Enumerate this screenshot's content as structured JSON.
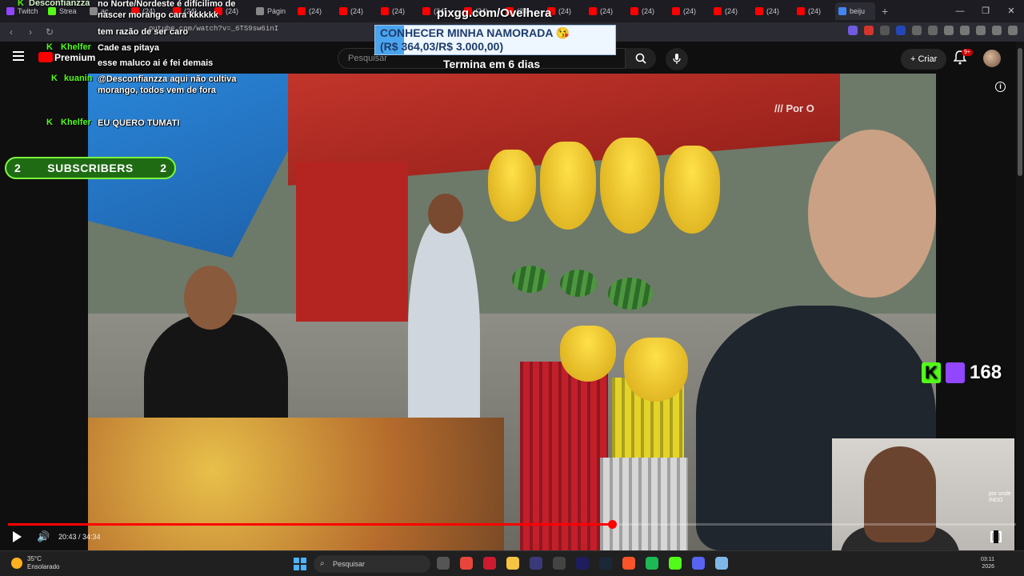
{
  "browser": {
    "tabs": [
      {
        "label": "Twitch",
        "color": "#9146ff"
      },
      {
        "label": "Strea",
        "color": "#53fc18"
      },
      {
        "label": "ac",
        "color": "#888888"
      },
      {
        "label": "(24)",
        "color": "#ff0000"
      },
      {
        "label": "(24)",
        "color": "#ff0000"
      },
      {
        "label": "(24)",
        "color": "#ff0000"
      },
      {
        "label": "Págin",
        "color": "#888888"
      },
      {
        "label": "(24)",
        "color": "#ff0000"
      },
      {
        "label": "(24)",
        "color": "#ff0000"
      },
      {
        "label": "(24)",
        "color": "#ff0000"
      },
      {
        "label": "(24)",
        "color": "#ff0000"
      },
      {
        "label": "(24)",
        "color": "#ff0000"
      },
      {
        "label": "(24)",
        "color": "#ff0000"
      },
      {
        "label": "(24)",
        "color": "#ff0000"
      },
      {
        "label": "(24)",
        "color": "#ff0000"
      },
      {
        "label": "(24)",
        "color": "#ff0000"
      },
      {
        "label": "(24)",
        "color": "#ff0000"
      },
      {
        "label": "(24)",
        "color": "#ff0000"
      },
      {
        "label": "(24)",
        "color": "#ff0000"
      },
      {
        "label": "(24)",
        "color": "#ff0000"
      },
      {
        "label": "beiju",
        "color": "#4285f4",
        "active": true
      }
    ],
    "address": "outube.com/watch?v=_6TS9sw6inI"
  },
  "youtube": {
    "premium_label": "Premium",
    "search_placeholder": "Pesquisar",
    "create_label": "Criar",
    "notif_badge": "9+"
  },
  "overlay": {
    "pix_banner": "pixgg.com/Ovelhera",
    "goal_title": "CONHECER MINHA NAMORADA 😘",
    "goal_amount": "(R$ 364,03/R$ 3.000,00)",
    "goal_progress": 0.1213,
    "goal_days": "Termina em 6 dias",
    "subs_left": "2",
    "subs_label": "SUBSCRIBERS",
    "subs_right": "2",
    "viewer_count": "168",
    "watermark": "/// Por O",
    "corner_logo": "por onde INDO"
  },
  "chat": [
    {
      "user": "Desconfianzza",
      "text": "no Norte/Nordeste é difícilimo de nascer morango cara kkkkkk"
    },
    {
      "user": "",
      "text": "tem razão de ser caro"
    },
    {
      "user": "Khelfer",
      "text": "Cade as pitaya"
    },
    {
      "user": "",
      "text": "esse maluco ai é fei demais"
    },
    {
      "user": "kuanin",
      "text": "@Desconfianzza aqui não cultiva morango, todos vem de fora"
    },
    {
      "user": "Khelfer",
      "text": "EU QUERO TUMATI"
    }
  ],
  "player": {
    "time": "20:43 / 34:34",
    "progress": 0.599
  },
  "taskbar": {
    "temp": "35°C",
    "weather": "Ensolarado",
    "search_label": "Pesquisar",
    "clock_time": "03:11",
    "clock_date": "2026",
    "apps": [
      {
        "name": "task-view-icon",
        "color": "#555555"
      },
      {
        "name": "chrome-icon",
        "color": "#e8453c"
      },
      {
        "name": "opera-icon",
        "color": "#cc1b2f"
      },
      {
        "name": "folder-icon",
        "color": "#f6c342"
      },
      {
        "name": "app-icon",
        "color": "#3a3a7a"
      },
      {
        "name": "obs-icon",
        "color": "#444444"
      },
      {
        "name": "arrow-app-icon",
        "color": "#1e1e5e"
      },
      {
        "name": "steam-icon",
        "color": "#1b2838"
      },
      {
        "name": "brave-icon",
        "color": "#fb542b"
      },
      {
        "name": "spotify-icon",
        "color": "#1db954"
      },
      {
        "name": "kick-app-icon",
        "color": "#53fc18"
      },
      {
        "name": "discord-icon",
        "color": "#5865f2"
      },
      {
        "name": "notes-icon",
        "color": "#7fb8e8"
      }
    ]
  }
}
